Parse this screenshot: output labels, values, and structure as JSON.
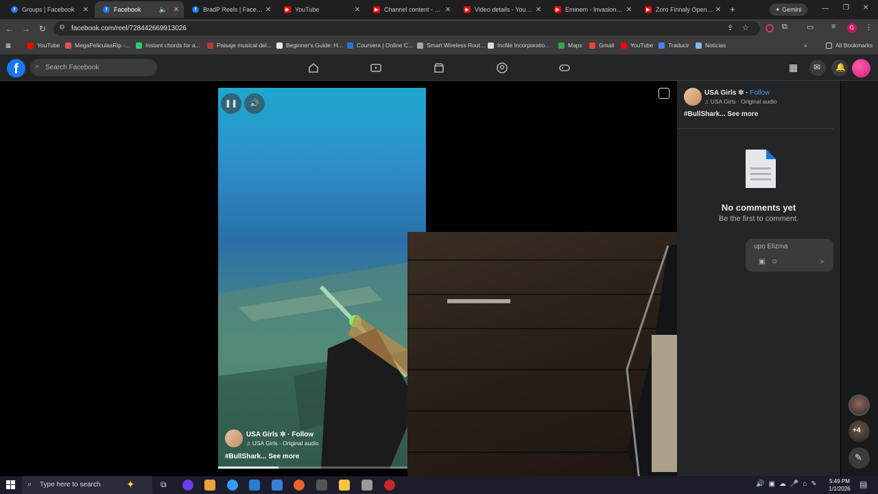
{
  "browser": {
    "tabs": [
      {
        "title": "Groups | Facebook",
        "favicon": "facebook-icon",
        "active": false
      },
      {
        "title": "Facebook",
        "favicon": "facebook-icon",
        "active": true
      },
      {
        "title": "BradP Reels | Facebook",
        "favicon": "facebook-icon",
        "active": false
      },
      {
        "title": "YouTube",
        "favicon": "youtube-icon",
        "active": false
      },
      {
        "title": "Channel content - YouT",
        "favicon": "youtube-icon",
        "active": false
      },
      {
        "title": "Video details - YouTub",
        "favicon": "youtube-icon",
        "active": false
      },
      {
        "title": "Eminem - Invasion (The",
        "favicon": "youtube-icon",
        "active": false
      },
      {
        "title": "Zoro Finnaly Opens His",
        "favicon": "youtube-icon",
        "active": false
      }
    ],
    "gemini_label": "Gemini",
    "url": "facebook.com/reel/728442669913026",
    "profile_initial": "G",
    "bookmarks": [
      {
        "label": "YouTube",
        "color": "#ff0000"
      },
      {
        "label": "MegaPeliculasRip -...",
        "color": "#d9534f"
      },
      {
        "label": "Instant chords for a...",
        "color": "#2ecc71"
      },
      {
        "label": "Paisaje musical del...",
        "color": "#c0392b"
      },
      {
        "label": "Beginner's Guide: H...",
        "color": "#eeeeee"
      },
      {
        "label": "Coursera | Online C...",
        "color": "#2a73cc"
      },
      {
        "label": "Smart Wireless Rout...",
        "color": "#aaaaaa"
      },
      {
        "label": "Incfile Incorporatio...",
        "color": "#dddddd"
      },
      {
        "label": "Maps",
        "color": "#34a853"
      },
      {
        "label": "Gmail",
        "color": "#ea4335"
      },
      {
        "label": "YouTube",
        "color": "#ff0000"
      },
      {
        "label": "Traducir",
        "color": "#4285f4"
      },
      {
        "label": "Noticias",
        "color": "#8ab4f8"
      }
    ],
    "all_bookmarks_label": "All Bookmarks"
  },
  "facebook": {
    "search_placeholder": "Search Facebook",
    "reel": {
      "author": "USA Girls",
      "follow_label": "Follow",
      "audio": "USA Girls · Original audio",
      "caption": "#BullShark...",
      "see_more": "See more",
      "progress": 0.29
    },
    "comments_panel": {
      "author": "USA Girls",
      "follow_label": "Follow",
      "audio": "USA Girls · Original audio",
      "caption": "#BullShark...",
      "see_more": "See more",
      "empty_title": "No comments yet",
      "empty_sub": "Be the first to comment.",
      "comment_placeholder_partial": "upo Elizma"
    },
    "rail": {
      "more_count": "+4"
    }
  },
  "taskbar": {
    "search_placeholder": "Type here to search",
    "time": "5:49 PM",
    "date": "1/1/2026"
  }
}
